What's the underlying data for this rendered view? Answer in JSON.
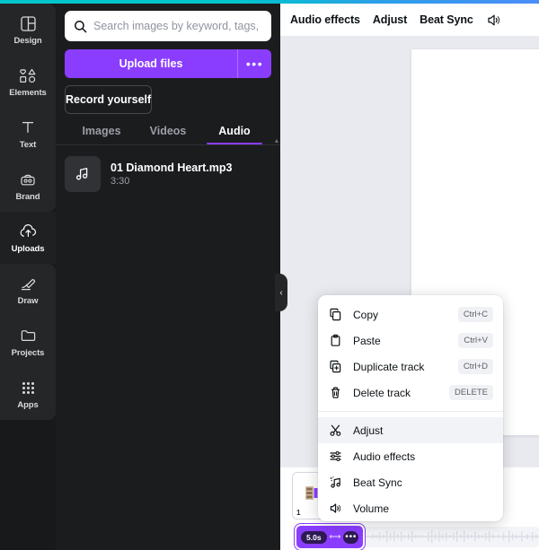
{
  "app": {
    "accent_color": "#00c4cc",
    "brand_purple": "#8b3dff"
  },
  "rail": {
    "items": [
      {
        "label": "Design",
        "icon": "design-icon",
        "active": false
      },
      {
        "label": "Elements",
        "icon": "elements-icon",
        "active": false
      },
      {
        "label": "Text",
        "icon": "text-icon",
        "active": false
      },
      {
        "label": "Brand",
        "icon": "brand-icon",
        "active": false
      },
      {
        "label": "Uploads",
        "icon": "uploads-icon",
        "active": true
      },
      {
        "label": "Draw",
        "icon": "draw-icon",
        "active": false
      },
      {
        "label": "Projects",
        "icon": "projects-icon",
        "active": false
      },
      {
        "label": "Apps",
        "icon": "apps-icon",
        "active": false
      }
    ]
  },
  "panel": {
    "search": {
      "placeholder": "Search images by keyword, tags, color...",
      "value": "",
      "icon": "search-icon"
    },
    "upload_label": "Upload files",
    "upload_more_label": "•••",
    "record_label": "Record yourself",
    "tabs": [
      {
        "label": "Images",
        "active": false
      },
      {
        "label": "Videos",
        "active": false
      },
      {
        "label": "Audio",
        "active": true
      }
    ],
    "files": [
      {
        "name": "01 Diamond Heart.mp3",
        "duration": "3:30",
        "icon": "music-note-icon"
      }
    ]
  },
  "collapse_handle": {
    "glyph": "‹"
  },
  "toolbar": {
    "items": [
      {
        "label": "Audio effects"
      },
      {
        "label": "Adjust"
      },
      {
        "label": "Beat Sync"
      }
    ],
    "volume_icon": "speaker-icon"
  },
  "timeline": {
    "page": {
      "number": "1"
    },
    "clip": {
      "duration_label": "5.0s",
      "more_label": "•••",
      "drag_handle": "⟷"
    }
  },
  "context_menu": {
    "groups": [
      {
        "items": [
          {
            "label": "Copy",
            "shortcut": "Ctrl+C",
            "icon": "copy-icon",
            "hover": false
          },
          {
            "label": "Paste",
            "shortcut": "Ctrl+V",
            "icon": "paste-icon",
            "hover": false
          },
          {
            "label": "Duplicate track",
            "shortcut": "Ctrl+D",
            "icon": "duplicate-icon",
            "hover": false
          },
          {
            "label": "Delete track",
            "shortcut": "DELETE",
            "icon": "trash-icon",
            "hover": false
          }
        ]
      },
      {
        "items": [
          {
            "label": "Adjust",
            "shortcut": "",
            "icon": "scissors-icon",
            "hover": true
          },
          {
            "label": "Audio effects",
            "shortcut": "",
            "icon": "equalizer-icon",
            "hover": false
          },
          {
            "label": "Beat Sync",
            "shortcut": "",
            "icon": "beat-sync-icon",
            "hover": false
          },
          {
            "label": "Volume",
            "shortcut": "",
            "icon": "speaker-icon",
            "hover": false
          }
        ]
      }
    ]
  }
}
